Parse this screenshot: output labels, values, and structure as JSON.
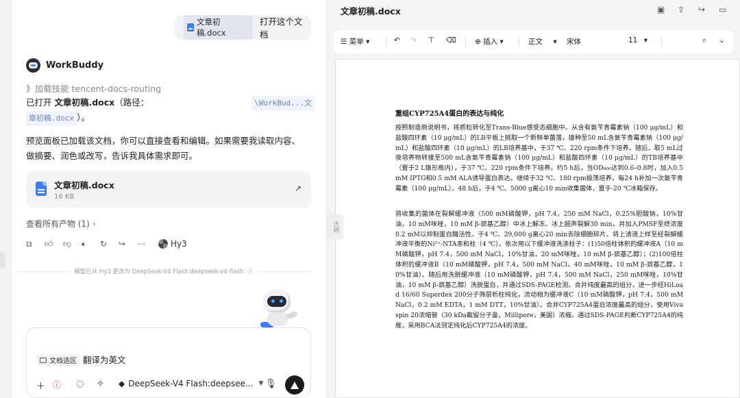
{
  "chat": {
    "user_message": {
      "file_chip": "文章初稿.docx",
      "text": "打开这个文档"
    },
    "bot": {
      "name": "WorkBuddy",
      "skill_line": "加载技能 tencent-docs-routing",
      "line1_prefix": "已打开 ",
      "line1_bold": "文章初稿.docx",
      "line1_suffix": "（路径：",
      "path_part1": "\\WorkBud...文",
      "path_part2": "章初稿.docx",
      "line2_suffix": "）。",
      "para_line1": "预览面板已加载该文档，你可以直接查看和编辑。如果需要我读取内容、",
      "para_line2": "做摘要、润色或改写，告诉我具体需求即可。"
    },
    "file_card": {
      "name": "文章初稿.docx",
      "size": "16 KB"
    },
    "all_products": "查看所有产物 (1)",
    "action_model": "Hy3",
    "model_change_note": "模型已从 Hy3 更改为 DeepSeek-V4 Flash:deepseek-v4-flash"
  },
  "composer": {
    "selection_chip": "文档选区",
    "input_text": "翻译为英文",
    "model": "DeepSeek-V4 Flash:deepsee..."
  },
  "handle_label": "大纲",
  "document": {
    "title": "文章初稿.docx",
    "toolbar": {
      "menu": "菜单",
      "insert": "插入",
      "style": "正文",
      "font": "宋体",
      "size": "11"
    },
    "heading": "重组CYP725A4蛋白的表达与纯化",
    "paragraphs": [
      "按照制造商说明书，将质粒转化至Trans-Blue感受态细胞中。从含有氨苄青霉素钠（100 μg/mL）和盐酸四环素（10 μg/mL）的LB平板上挑取一个新鲜单菌落，接种至50 mL含氨苄青霉素钠（100 μg/mL）和盐酸四环素（10 μg/mL）的LB培养基中，于37 ℃、220 rpm条件下培养。随后，取5 mL过夜培养物转接至500 mL含氨苄青霉素钠（100 μg/mL）和盐酸四环素（10 μg/mL）的TB培养基中（置于2 L锥形瓶内），于37 ℃、220 rpm条件下培养。约5 h后，当OD₆₀₀达到0.6–0.8时，加入0.5 mM IPTG和0.5 mM ALA诱导蛋白表达。继续于32 ℃、180 rpm振荡培养。每24 h补加一次氨苄青霉素（100 μg/mL）。48 h后，于4 ℃、5000 g离心10 min收集菌体，置于-20 ℃冰箱保存。",
      "将收集的菌体在裂解缓冲液（500 mM磷酸钾，pH 7.4，250 mM NaCl，0.25%胆酸钠，10%甘油，10 mM咪唑，10 mM β-巯基乙醇）中冰上解冻。冰上超声裂解30 min，并加入PMSF至终浓度0.2 mM以抑制蛋白酶活性。于4 ℃、29,000 g离心20 min去除细胞碎片。将上清液上样至经裂解缓冲液平衡的Ni²⁺-NTA亲和柱（4 ℃）。依次用以下缓冲液洗涤柱子：(1)50倍柱体积的缓冲液A（10 mM磷酸钾，pH 7.4，500 mM NaCl，10%甘油，20 mM咪唑，10 mM β-巯基乙醇）；(2)100倍柱体积的缓冲液B（10 mM磷酸钾，pH 7.4，500 mM NaCl，40 mM咪唑，10 mM β-巯基乙醇，10%甘油）。随后用洗脱缓冲液（10 mM磷酸钾，pH 7.4，500 mM NaCl，250 mM咪唑，10%甘油，10 mM β-巯基乙醇）洗脱蛋白，并通过SDS-PAGE检测。合并纯度最高的组分，进一步经HiLoad 16/60 Superdex 200分子筛层析柱纯化，流动相为缓冲液C（10 mM磷酸钾，pH 7.4，500 mM NaCl，0.2 mM EDTA，1 mM DTT，10%甘油）。合并CYP725A4蛋白浓度最高的组分，使用Vivaspin 20浓缩管（30 kDa截留分子量，Millipore，美国）浓缩。通过SDS-PAGE判断CYP725A4的纯度，采用BCA法测定纯化后CYP725A4的浓度。"
    ]
  },
  "colors": {
    "accent": "#3d7cf4",
    "send_button": "#1c1c1c",
    "pane_bg": "#f3f4f6"
  }
}
